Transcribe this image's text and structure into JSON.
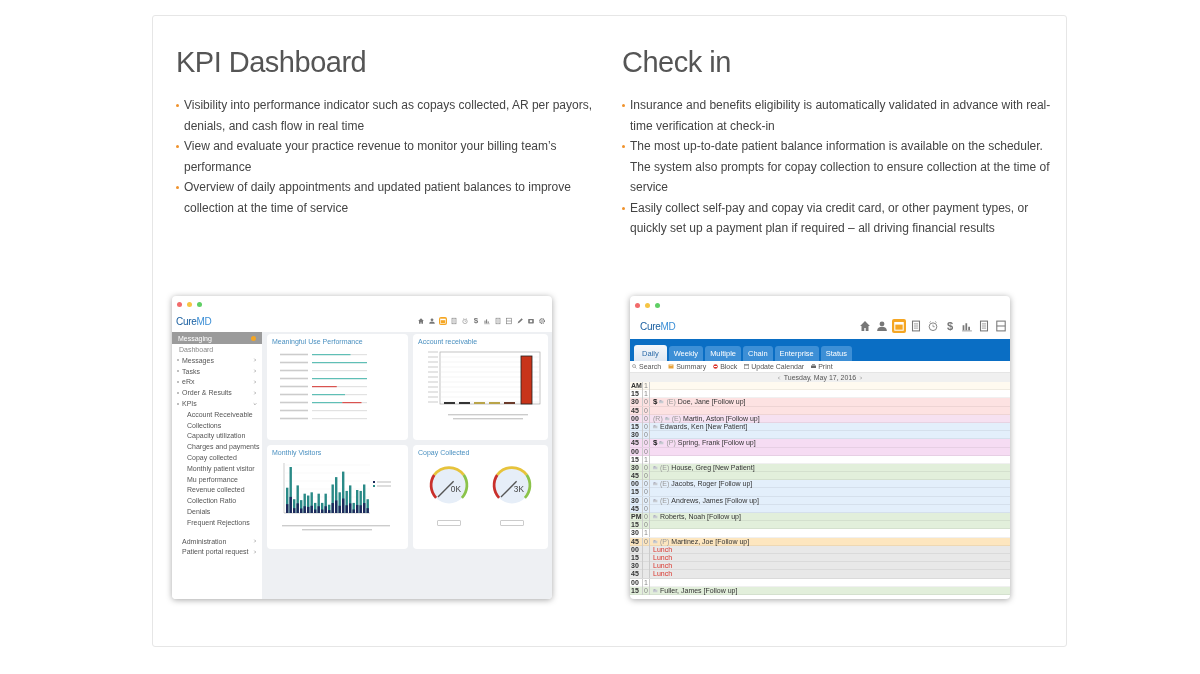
{
  "features": [
    {
      "title": "KPI Dashboard",
      "bullets": [
        "Visibility into performance indicator such as copays collected, AR per payors, denials, and cash flow in real time",
        "View and evaluate your practice revenue to monitor your billing team’s performance",
        "Overview of daily appointments and updated patient balances to improve collection at the time of service"
      ]
    },
    {
      "title": "Check in",
      "bullets": [
        "Insurance and benefits eligibility is automatically validated in advance with real-time verification at check-in",
        "The most up-to-date patient balance information is available on the scheduler. The system also prompts for copay collection to ensure collection at the time of service",
        "Easily collect self-pay and copay via credit card, or other payment types, or quickly set up a payment plan if required – all driving financial results"
      ]
    }
  ],
  "dashboard": {
    "logo": {
      "brand": "Cure",
      "suffix": "MD"
    },
    "toolbar": [
      {
        "kind": "home",
        "selected": false
      },
      {
        "kind": "person",
        "selected": false
      },
      {
        "kind": "calendar",
        "selected": true
      },
      {
        "kind": "document",
        "selected": false
      },
      {
        "kind": "clock",
        "selected": false
      },
      {
        "kind": "text",
        "label": "$",
        "selected": false
      },
      {
        "kind": "chart",
        "selected": false
      },
      {
        "kind": "document",
        "selected": false
      },
      {
        "kind": "columns",
        "selected": false
      },
      {
        "kind": "pencil",
        "selected": false
      },
      {
        "kind": "box",
        "selected": false
      },
      {
        "kind": "gear",
        "selected": false
      }
    ],
    "sidebar": {
      "header": "Messaging",
      "section": "Dashboard",
      "items": [
        {
          "label": "Messages",
          "expanded": false
        },
        {
          "label": "Tasks",
          "expanded": false
        },
        {
          "label": "eRx",
          "expanded": false
        },
        {
          "label": "Order & Results",
          "expanded": false
        },
        {
          "label": "KPIs",
          "expanded": true,
          "children": [
            {
              "label": "Account Receiveable"
            },
            {
              "label": "Collections"
            },
            {
              "label": "Capacity utilization"
            },
            {
              "label": "Charges and payments"
            },
            {
              "label": "Copay collected"
            },
            {
              "label": "Monthly patient visitor"
            },
            {
              "label": "Mu performance"
            },
            {
              "label": "Revenue collected"
            },
            {
              "label": "Collection Ratio"
            },
            {
              "label": "Denials"
            },
            {
              "label": "Frequent Rejections"
            }
          ]
        },
        {
          "label": "Administration",
          "expanded": false
        },
        {
          "label": "Patient portal request",
          "expanded": false
        }
      ]
    },
    "panels": [
      {
        "title": "Meaningful Use Performance",
        "kind": "progress"
      },
      {
        "title": "Account receivable",
        "kind": "column"
      },
      {
        "title": "Monthly Visitors",
        "kind": "stacked"
      },
      {
        "title": "Copay Collected",
        "kind": "gauges",
        "readings": [
          "0K",
          "3K"
        ]
      }
    ]
  },
  "scheduler": {
    "logo": {
      "brand": "Cure",
      "suffix": "MD"
    },
    "toolbar": [
      {
        "kind": "home",
        "selected": false
      },
      {
        "kind": "person",
        "selected": false
      },
      {
        "kind": "calendar",
        "selected": true
      },
      {
        "kind": "document",
        "selected": false
      },
      {
        "kind": "clock",
        "selected": false
      },
      {
        "kind": "text",
        "label": "$",
        "selected": false
      },
      {
        "kind": "chart",
        "selected": false
      },
      {
        "kind": "document",
        "selected": false
      },
      {
        "kind": "columns",
        "selected": false
      }
    ],
    "tabs": [
      {
        "label": "Daily",
        "selected": true
      },
      {
        "label": "Weekly",
        "selected": false
      },
      {
        "label": "Multiple",
        "selected": false
      },
      {
        "label": "Chain",
        "selected": false
      },
      {
        "label": "Enterprise",
        "selected": false
      },
      {
        "label": "Status",
        "selected": false
      }
    ],
    "actions": [
      {
        "kind": "search",
        "label": "Search"
      },
      {
        "kind": "summary",
        "label": "Summary"
      },
      {
        "kind": "block",
        "label": "Block"
      },
      {
        "kind": "update",
        "label": "Update Calendar"
      },
      {
        "kind": "print",
        "label": "Print"
      }
    ],
    "date": "Tuesday, May 17, 2016",
    "rows": [
      {
        "time": "AM",
        "count": "1",
        "kind": "empty",
        "color": "#fffaf0"
      },
      {
        "time": "15",
        "count": "1",
        "kind": "empty",
        "color": "#ffffff"
      },
      {
        "time": "30",
        "count": "0",
        "kind": "appointment",
        "color": "#fde2e2",
        "dollar": "$",
        "tag": "(E)",
        "text": "Doe, Jane [Follow up]"
      },
      {
        "time": "45",
        "count": "0",
        "kind": "empty",
        "color": "#fde2e2"
      },
      {
        "time": "00",
        "count": "0",
        "kind": "appointment",
        "color": "#f6e1f1",
        "pre": "(R)",
        "tag": "(E)",
        "text": "Martin, Aston [Follow up]"
      },
      {
        "time": "15",
        "count": "0",
        "kind": "appointment",
        "color": "#e3effb",
        "text": "Edwards, Ken [New Patient]"
      },
      {
        "time": "30",
        "count": "0",
        "kind": "empty",
        "color": "#e3effb"
      },
      {
        "time": "45",
        "count": "0",
        "kind": "appointment",
        "color": "#f6dcf3",
        "dollar": "$",
        "tag": "(P)",
        "text": "Spring, Frank [Follow up]"
      },
      {
        "time": "00",
        "count": "0",
        "kind": "empty",
        "color": "#f6dcf3"
      },
      {
        "time": "15",
        "count": "1",
        "kind": "empty",
        "color": "#ffffff"
      },
      {
        "time": "30",
        "count": "0",
        "kind": "appointment",
        "color": "#e2efdb",
        "tag": "(E)",
        "text": "House, Greg [New Patient]"
      },
      {
        "time": "45",
        "count": "0",
        "kind": "empty",
        "color": "#e2efdb"
      },
      {
        "time": "00",
        "count": "0",
        "kind": "appointment",
        "color": "#e3effb",
        "tag": "(E)",
        "text": "Jacobs, Roger [Follow up]"
      },
      {
        "time": "15",
        "count": "0",
        "kind": "empty",
        "color": "#e3effb"
      },
      {
        "time": "30",
        "count": "0",
        "kind": "appointment",
        "color": "#e3effb",
        "tag": "(E)",
        "text": "Andrews, James [Follow up]"
      },
      {
        "time": "45",
        "count": "0",
        "kind": "empty",
        "color": "#e3effb"
      },
      {
        "time": "PM",
        "count": "0",
        "kind": "appointment",
        "color": "#e2efdb",
        "text": "Roberts, Noah [Follow up]"
      },
      {
        "time": "15",
        "count": "0",
        "kind": "empty",
        "color": "#e2efdb"
      },
      {
        "time": "30",
        "count": "1",
        "kind": "empty",
        "color": "#ffffff"
      },
      {
        "time": "45",
        "count": "0",
        "kind": "appointment",
        "color": "#fde6bf",
        "tag": "(P)",
        "text": "Martinez, Joe [Follow up]"
      },
      {
        "time": "00",
        "kind": "lunch",
        "color": "#e8e8e8",
        "text": "Lunch"
      },
      {
        "time": "15",
        "kind": "lunch",
        "color": "#e8e8e8",
        "text": "Lunch"
      },
      {
        "time": "30",
        "kind": "lunch",
        "color": "#e8e8e8",
        "text": "Lunch"
      },
      {
        "time": "45",
        "kind": "lunch",
        "color": "#e8e8e8",
        "text": "Lunch"
      },
      {
        "time": "00",
        "count": "1",
        "kind": "empty",
        "color": "#ffffff"
      },
      {
        "time": "15",
        "count": "0",
        "kind": "appointment",
        "color": "#e2efdb",
        "text": "Fuller, James [Follow up]"
      }
    ]
  }
}
